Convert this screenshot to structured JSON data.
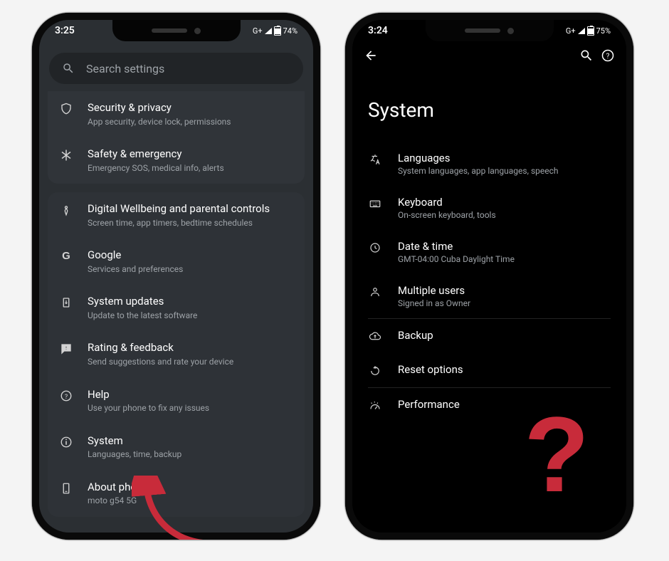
{
  "left": {
    "status": {
      "time": "3:25",
      "net": "G+",
      "battery": "74%"
    },
    "search_placeholder": "Search settings",
    "items": [
      {
        "title": "Security & privacy",
        "sub": "App security, device lock, permissions"
      },
      {
        "title": "Safety & emergency",
        "sub": "Emergency SOS, medical info, alerts"
      },
      {
        "title": "Digital Wellbeing and parental controls",
        "sub": "Screen time, app timers, bedtime schedules"
      },
      {
        "title": "Google",
        "sub": "Services and preferences"
      },
      {
        "title": "System updates",
        "sub": "Update to the latest software"
      },
      {
        "title": "Rating & feedback",
        "sub": "Send suggestions and rate your device"
      },
      {
        "title": "Help",
        "sub": "Use your phone to fix any issues"
      },
      {
        "title": "System",
        "sub": "Languages, time, backup"
      },
      {
        "title": "About phone",
        "sub": "moto g54 5G"
      }
    ]
  },
  "right": {
    "status": {
      "time": "3:24",
      "net": "G+",
      "battery": "75%"
    },
    "heading": "System",
    "items": [
      {
        "title": "Languages",
        "sub": "System languages, app languages, speech"
      },
      {
        "title": "Keyboard",
        "sub": "On-screen keyboard, tools"
      },
      {
        "title": "Date & time",
        "sub": "GMT-04:00 Cuba Daylight Time"
      },
      {
        "title": "Multiple users",
        "sub": "Signed in as Owner"
      },
      {
        "title": "Backup",
        "sub": ""
      },
      {
        "title": "Reset options",
        "sub": ""
      },
      {
        "title": "Performance",
        "sub": ""
      }
    ]
  }
}
